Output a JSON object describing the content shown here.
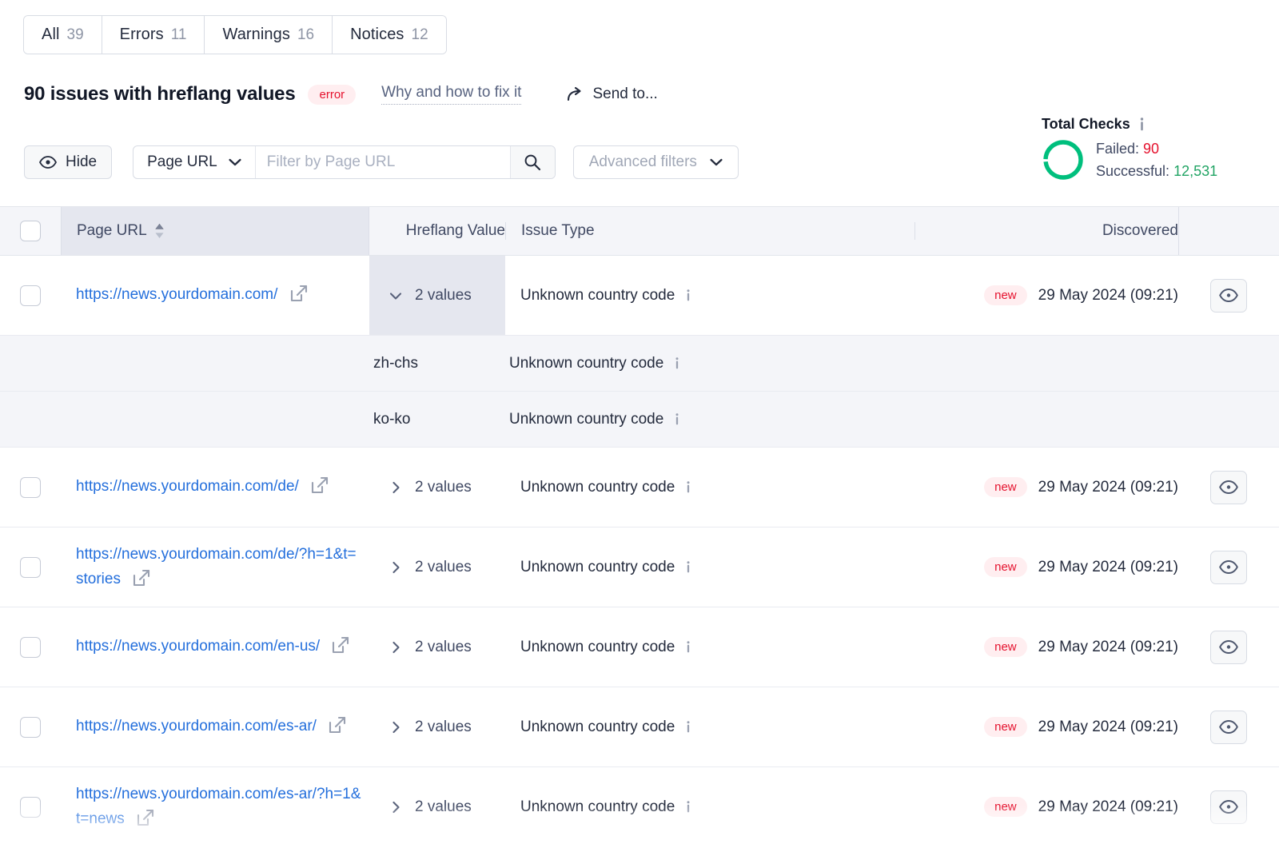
{
  "tabs": [
    {
      "label": "All",
      "count": "39"
    },
    {
      "label": "Errors",
      "count": "11"
    },
    {
      "label": "Warnings",
      "count": "16"
    },
    {
      "label": "Notices",
      "count": "12"
    }
  ],
  "header": {
    "title": "90 issues with hreflang values",
    "severity_badge": "error",
    "why_link": "Why and how to fix it",
    "send_to": "Send to..."
  },
  "toolbar": {
    "hide_label": "Hide",
    "filter_field": "Page URL",
    "filter_placeholder": "Filter by Page URL",
    "filter_value": "",
    "advanced_filters": "Advanced filters"
  },
  "total_checks": {
    "title": "Total Checks",
    "failed_label": "Failed:",
    "failed_value": "90",
    "successful_label": "Successful:",
    "successful_value": "12,531",
    "donut_color": "#00bf7d"
  },
  "table": {
    "columns": {
      "page_url": "Page URL",
      "hreflang_value": "Hreflang Value",
      "issue_type": "Issue Type",
      "discovered": "Discovered"
    },
    "sorted_column": "Page URL",
    "rows": [
      {
        "url": "https://news.yourdomain.com/",
        "values_label": "2 values",
        "expanded": true,
        "issue_type": "Unknown country code",
        "badge": "new",
        "discovered": "29 May 2024 (09:21)",
        "children": [
          {
            "value": "zh-chs",
            "issue_type": "Unknown country code"
          },
          {
            "value": "ko-ko",
            "issue_type": "Unknown country code"
          }
        ]
      },
      {
        "url": "https://news.yourdomain.com/de/",
        "values_label": "2 values",
        "expanded": false,
        "issue_type": "Unknown country code",
        "badge": "new",
        "discovered": "29 May 2024 (09:21)"
      },
      {
        "url": "https://news.yourdomain.com/de/?h=1&t=stories",
        "values_label": "2 values",
        "expanded": false,
        "issue_type": "Unknown country code",
        "badge": "new",
        "discovered": "29 May 2024 (09:21)"
      },
      {
        "url": "https://news.yourdomain.com/en-us/",
        "values_label": "2 values",
        "expanded": false,
        "issue_type": "Unknown country code",
        "badge": "new",
        "discovered": "29 May 2024 (09:21)"
      },
      {
        "url": "https://news.yourdomain.com/es-ar/",
        "values_label": "2 values",
        "expanded": false,
        "issue_type": "Unknown country code",
        "badge": "new",
        "discovered": "29 May 2024 (09:21)"
      },
      {
        "url": "https://news.yourdomain.com/es-ar/?h=1&t=news",
        "values_label": "2 values",
        "expanded": false,
        "issue_type": "Unknown country code",
        "badge": "new",
        "discovered": "29 May 2024 (09:21)"
      }
    ]
  },
  "colors": {
    "link": "#246fdc",
    "error": "#e5122e",
    "success": "#21a464",
    "header_bg": "#f4f5f9",
    "sorted_bg": "#e5e7ef"
  }
}
